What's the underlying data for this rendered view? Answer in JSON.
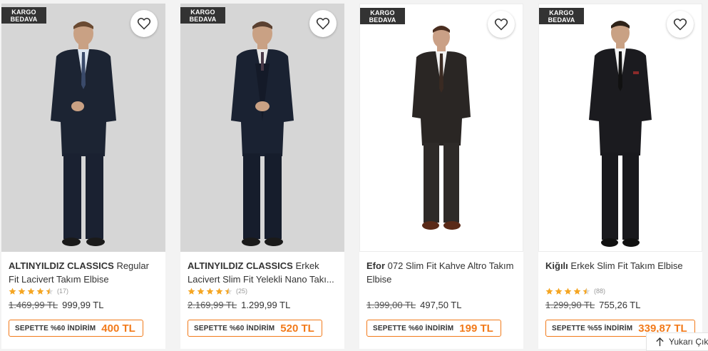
{
  "products": [
    {
      "badge_line1": "KARGO",
      "badge_line2": "BEDAVA",
      "brand": "ALTINYILDIZ CLASSICS",
      "name": "Regular Fit Lacivert Takım Elbise",
      "rating": 4.5,
      "rating_count": "(17)",
      "old_price": "1.469,99 TL",
      "price": "999,99 TL",
      "cart_label": "SEPETTE %60 İNDİRİM",
      "cart_price": "400 TL",
      "image_style": "grey",
      "suit_color": "#1c2433"
    },
    {
      "badge_line1": "KARGO",
      "badge_line2": "BEDAVA",
      "brand": "ALTINYILDIZ CLASSICS",
      "name": "Erkek Lacivert Slim Fit Yelekli Nano Takı...",
      "rating": 4.5,
      "rating_count": "(25)",
      "old_price": "2.169,99 TL",
      "price": "1.299,99 TL",
      "cart_label": "SEPETTE %60 İNDİRİM",
      "cart_price": "520 TL",
      "image_style": "grey",
      "suit_color": "#1a2232"
    },
    {
      "badge_line1": "KARGO",
      "badge_line2": "BEDAVA",
      "brand": "Efor",
      "name": "072 Slim Fit Kahve Altro Takım Elbise",
      "rating": null,
      "rating_count": "",
      "old_price": "1.399,00 TL",
      "price": "497,50 TL",
      "cart_label": "SEPETTE %60 İNDİRİM",
      "cart_price": "199 TL",
      "image_style": "white",
      "suit_color": "#2a2624"
    },
    {
      "badge_line1": "KARGO",
      "badge_line2": "BEDAVA",
      "brand": "Kiğılı",
      "name": "Erkek Slim Fit Takım Elbise",
      "rating": 4.5,
      "rating_count": "(88)",
      "old_price": "1.299,90 TL",
      "price": "755,26 TL",
      "cart_label": "SEPETTE %55 İNDİRİM",
      "cart_price": "339,87 TL",
      "image_style": "white",
      "suit_color": "#1b1b1f"
    }
  ],
  "scroll_up_label": "Yukarı Çık",
  "colors": {
    "accent": "#f27a1a",
    "star": "#f5a623"
  }
}
